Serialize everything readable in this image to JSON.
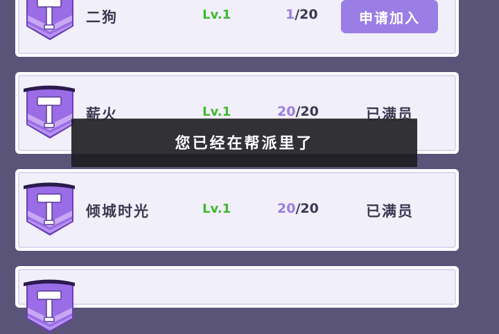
{
  "guild_list": {
    "items": [
      {
        "name": "二狗",
        "level": "Lv.1",
        "members_current": "1",
        "members_max": "/20",
        "action": "申请加入",
        "is_full": false
      },
      {
        "name": "薪火",
        "level": "Lv.1",
        "members_current": "20",
        "members_max": "/20",
        "action": "已满员",
        "is_full": true
      },
      {
        "name": "倾城时光",
        "level": "Lv.1",
        "members_current": "20",
        "members_max": "/20",
        "action": "已满员",
        "is_full": true
      }
    ]
  },
  "toast": {
    "message": "您已经在帮派里了"
  },
  "colors": {
    "accent": "#9b7de6",
    "level": "#3fba2e",
    "members_current": "#9b7ee2",
    "background": "#5a5478"
  },
  "icons": {
    "emblem": "hammer-banner-icon"
  }
}
